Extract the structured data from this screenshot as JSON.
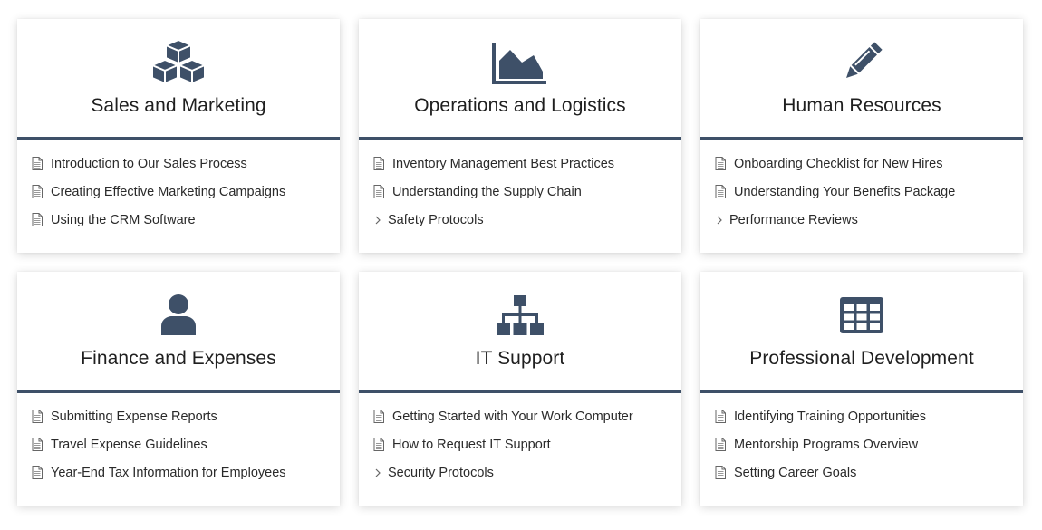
{
  "colors": {
    "accent": "#3e5068",
    "icon": "#3e5068"
  },
  "cards": [
    {
      "icon": "cubes-icon",
      "title": "Sales and Marketing",
      "items": [
        {
          "label": "Introduction to Our Sales Process",
          "type": "document"
        },
        {
          "label": "Creating Effective Marketing Campaigns",
          "type": "document"
        },
        {
          "label": "Using the CRM Software",
          "type": "document"
        }
      ]
    },
    {
      "icon": "area-chart-icon",
      "title": "Operations and Logistics",
      "items": [
        {
          "label": "Inventory Management Best Practices",
          "type": "document"
        },
        {
          "label": "Understanding the Supply Chain",
          "type": "document"
        },
        {
          "label": "Safety Protocols",
          "type": "folder"
        }
      ]
    },
    {
      "icon": "pencil-icon",
      "title": "Human Resources",
      "items": [
        {
          "label": "Onboarding Checklist for New Hires",
          "type": "document"
        },
        {
          "label": "Understanding Your Benefits Package",
          "type": "document"
        },
        {
          "label": "Performance Reviews",
          "type": "folder"
        }
      ]
    },
    {
      "icon": "user-icon",
      "title": "Finance and Expenses",
      "items": [
        {
          "label": "Submitting Expense Reports",
          "type": "document"
        },
        {
          "label": "Travel Expense Guidelines",
          "type": "document"
        },
        {
          "label": "Year-End Tax Information for Employees",
          "type": "document"
        }
      ]
    },
    {
      "icon": "sitemap-icon",
      "title": "IT Support",
      "items": [
        {
          "label": "Getting Started with Your Work Computer",
          "type": "document"
        },
        {
          "label": "How to Request IT Support",
          "type": "document"
        },
        {
          "label": "Security Protocols",
          "type": "folder"
        }
      ]
    },
    {
      "icon": "table-icon",
      "title": "Professional Development",
      "items": [
        {
          "label": "Identifying Training Opportunities",
          "type": "document"
        },
        {
          "label": "Mentorship Programs Overview",
          "type": "document"
        },
        {
          "label": "Setting Career Goals",
          "type": "document"
        }
      ]
    }
  ]
}
